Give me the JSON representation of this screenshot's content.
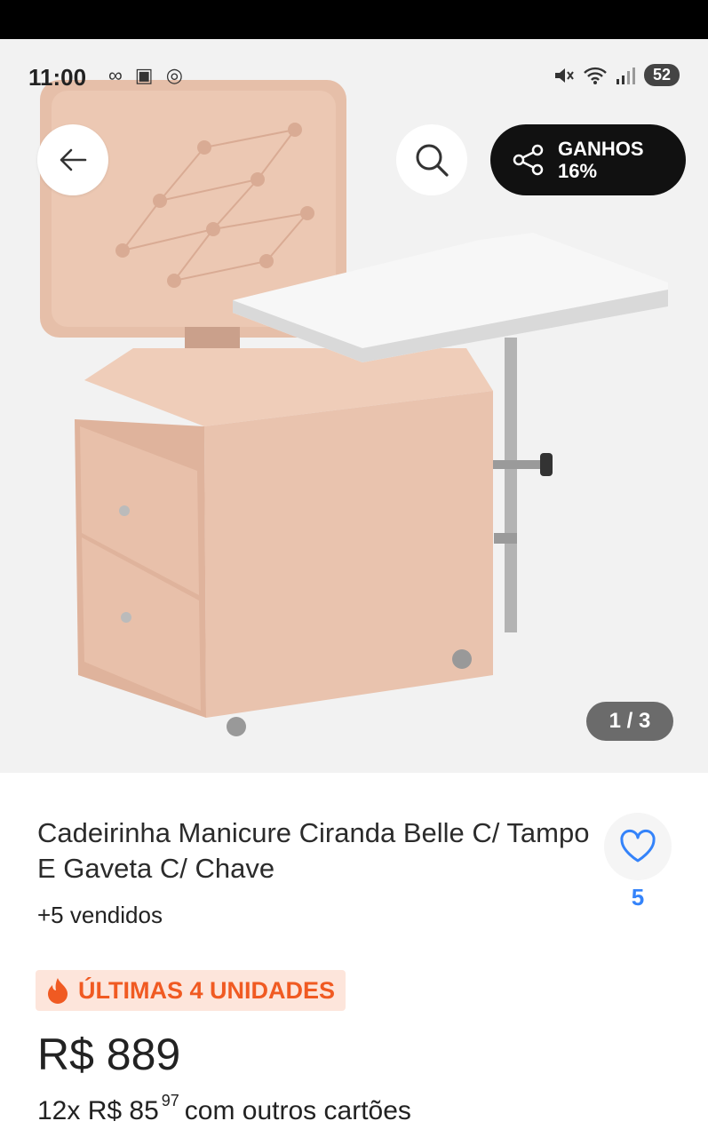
{
  "status_bar": {
    "time": "11:00",
    "left_icons": "∞ ▣ ◎",
    "battery": "52"
  },
  "gallery": {
    "counter": "1 / 3",
    "image_description_icon": "manicure-chair-image"
  },
  "actions": {
    "back_icon": "arrow-left-icon",
    "search_icon": "search-icon",
    "share_icon": "share-icon",
    "ganhos_label": "GANHOS",
    "ganhos_value": "16%"
  },
  "product": {
    "title": "Cadeirinha Manicure Ciranda Belle C/ Tampo E Gaveta C/ Chave",
    "sold": "+5 vendidos",
    "favorites_count": "5",
    "badge": "ÚLTIMAS 4 UNIDADES",
    "price": "R$ 889",
    "installments_prefix": "12x R$ 85",
    "installments_cents": "97",
    "installments_suffix": "com outros cartões"
  },
  "colors": {
    "accent_blue": "#3483fa",
    "badge_orange": "#f05a22",
    "badge_bg": "#fde5db",
    "chair_pink": "#e7c1ac"
  }
}
